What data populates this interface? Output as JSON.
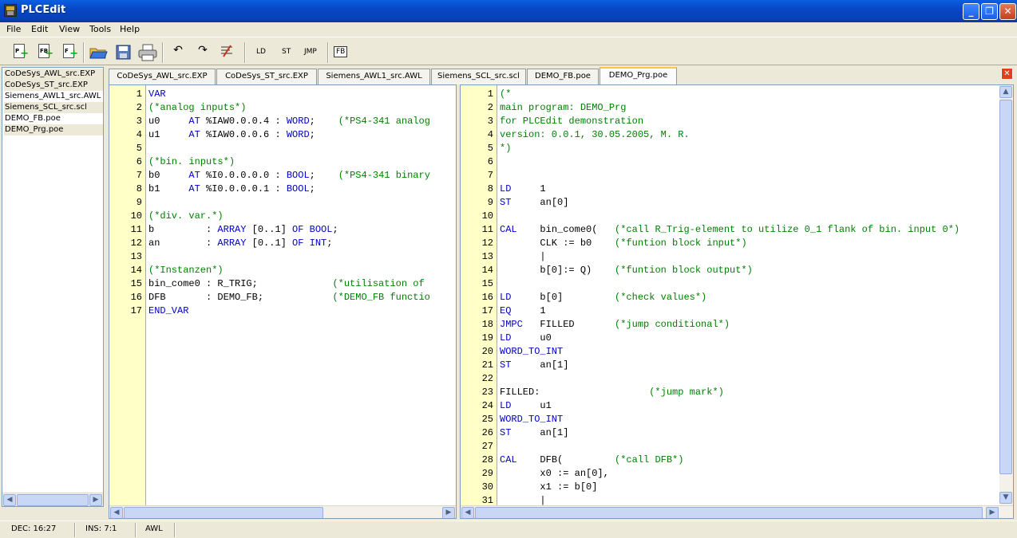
{
  "window": {
    "title": "PLCEdit"
  },
  "menu": [
    "File",
    "Edit",
    "View",
    "Tools",
    "Help"
  ],
  "toolbar": {
    "new_program_glyph": "P",
    "new_fb_glyph": "FB",
    "new_function_glyph": "F",
    "ld_label": "LD",
    "st_label": "ST",
    "jmp_label": "JMP",
    "fb_label": "FB"
  },
  "files": [
    "CoDeSys_AWL_src.EXP",
    "CoDeSys_ST_src.EXP",
    "Siemens_AWL1_src.AWL",
    "Siemens_SCL_src.scl",
    "DEMO_FB.poe",
    "DEMO_Prg.poe"
  ],
  "tabs": [
    "CoDeSys_AWL_src.EXP",
    "CoDeSys_ST_src.EXP",
    "Siemens_AWL1_src.AWL",
    "Siemens_SCL_src.scl",
    "DEMO_FB.poe",
    "DEMO_Prg.poe"
  ],
  "active_tab": "DEMO_Prg.poe",
  "left_editor": {
    "line_numbers": [
      "1",
      "2",
      "3",
      "4",
      "5",
      "6",
      "7",
      "8",
      "9",
      "10",
      "11",
      "12",
      "13",
      "14",
      "15",
      "16",
      "17"
    ],
    "lines": [
      [
        {
          "t": "VAR",
          "c": "k"
        }
      ],
      [
        {
          "t": "(*analog inputs*)",
          "c": "c"
        }
      ],
      [
        {
          "t": "u0     "
        },
        {
          "t": "AT",
          "c": "k"
        },
        {
          "t": " %IAW0.0.0.4 : "
        },
        {
          "t": "WORD",
          "c": "k"
        },
        {
          "t": ";    "
        },
        {
          "t": "(*PS4-341 analog",
          "c": "c"
        }
      ],
      [
        {
          "t": "u1     "
        },
        {
          "t": "AT",
          "c": "k"
        },
        {
          "t": " %IAW0.0.0.6 : "
        },
        {
          "t": "WORD",
          "c": "k"
        },
        {
          "t": ";"
        }
      ],
      [],
      [
        {
          "t": "(*bin. inputs*)",
          "c": "c"
        }
      ],
      [
        {
          "t": "b0     "
        },
        {
          "t": "AT",
          "c": "k"
        },
        {
          "t": " %I0.0.0.0.0 : "
        },
        {
          "t": "BOOL",
          "c": "k"
        },
        {
          "t": ";    "
        },
        {
          "t": "(*PS4-341 binary",
          "c": "c"
        }
      ],
      [
        {
          "t": "b1     "
        },
        {
          "t": "AT",
          "c": "k"
        },
        {
          "t": " %I0.0.0.0.1 : "
        },
        {
          "t": "BOOL",
          "c": "k"
        },
        {
          "t": ";"
        }
      ],
      [],
      [
        {
          "t": "(*div. var.*)",
          "c": "c"
        }
      ],
      [
        {
          "t": "b         : "
        },
        {
          "t": "ARRAY",
          "c": "k"
        },
        {
          "t": " [0..1] "
        },
        {
          "t": "OF",
          "c": "k"
        },
        {
          "t": " "
        },
        {
          "t": "BOOL",
          "c": "k"
        },
        {
          "t": ";"
        }
      ],
      [
        {
          "t": "an        : "
        },
        {
          "t": "ARRAY",
          "c": "k"
        },
        {
          "t": " [0..1] "
        },
        {
          "t": "OF",
          "c": "k"
        },
        {
          "t": " "
        },
        {
          "t": "INT",
          "c": "k"
        },
        {
          "t": ";"
        }
      ],
      [],
      [
        {
          "t": "(*Instanzen*)",
          "c": "c"
        }
      ],
      [
        {
          "t": "bin_come0 : R_TRIG;             "
        },
        {
          "t": "(*utilisation of",
          "c": "c"
        }
      ],
      [
        {
          "t": "DFB       : DEMO_FB;            "
        },
        {
          "t": "(*DEMO_FB functio",
          "c": "c"
        }
      ],
      [
        {
          "t": "END_VAR",
          "c": "k"
        }
      ]
    ]
  },
  "right_editor": {
    "line_numbers": [
      "1",
      "2",
      "3",
      "4",
      "5",
      "6",
      "7",
      "8",
      "9",
      "10",
      "11",
      "12",
      "13",
      "14",
      "15",
      "16",
      "17",
      "18",
      "19",
      "20",
      "21",
      "22",
      "23",
      "24",
      "25",
      "26",
      "27",
      "28",
      "29",
      "30",
      "31"
    ],
    "lines": [
      [
        {
          "t": "(*",
          "c": "c"
        }
      ],
      [
        {
          "t": "main program: DEMO_Prg",
          "c": "c"
        }
      ],
      [
        {
          "t": "for PLCEdit demonstration",
          "c": "c"
        }
      ],
      [
        {
          "t": "version: 0.0.1, 30.05.2005, M. R.",
          "c": "c"
        }
      ],
      [
        {
          "t": "*)",
          "c": "c"
        }
      ],
      [],
      [],
      [
        {
          "t": "LD",
          "c": "k"
        },
        {
          "t": "     1"
        }
      ],
      [
        {
          "t": "ST",
          "c": "k"
        },
        {
          "t": "     an[0]"
        }
      ],
      [],
      [
        {
          "t": "CAL",
          "c": "k"
        },
        {
          "t": "    bin_come0(   "
        },
        {
          "t": "(*call R_Trig-element to utilize 0_1 flank of bin. input 0*)",
          "c": "c"
        }
      ],
      [
        {
          "t": "       CLK := b0    "
        },
        {
          "t": "(*funtion block input*)",
          "c": "c"
        }
      ],
      [
        {
          "t": "       |"
        }
      ],
      [
        {
          "t": "       b[0]:= Q)    "
        },
        {
          "t": "(*funtion block output*)",
          "c": "c"
        }
      ],
      [],
      [
        {
          "t": "LD",
          "c": "k"
        },
        {
          "t": "     b[0]         "
        },
        {
          "t": "(*check values*)",
          "c": "c"
        }
      ],
      [
        {
          "t": "EQ",
          "c": "k"
        },
        {
          "t": "     1"
        }
      ],
      [
        {
          "t": "JMPC",
          "c": "k"
        },
        {
          "t": "   FILLED       "
        },
        {
          "t": "(*jump conditional*)",
          "c": "c"
        }
      ],
      [
        {
          "t": "LD",
          "c": "k"
        },
        {
          "t": "     u0"
        }
      ],
      [
        {
          "t": "WORD_TO_INT",
          "c": "k"
        }
      ],
      [
        {
          "t": "ST",
          "c": "k"
        },
        {
          "t": "     an[1]"
        }
      ],
      [],
      [
        {
          "t": "FILLED:                   "
        },
        {
          "t": "(*jump mark*)",
          "c": "c"
        }
      ],
      [
        {
          "t": "LD",
          "c": "k"
        },
        {
          "t": "     u1"
        }
      ],
      [
        {
          "t": "WORD_TO_INT",
          "c": "k"
        }
      ],
      [
        {
          "t": "ST",
          "c": "k"
        },
        {
          "t": "     an[1]"
        }
      ],
      [],
      [
        {
          "t": "CAL",
          "c": "k"
        },
        {
          "t": "    DFB(         "
        },
        {
          "t": "(*call DFB*)",
          "c": "c"
        }
      ],
      [
        {
          "t": "       x0 := an[0],"
        }
      ],
      [
        {
          "t": "       x1 := b[0]"
        }
      ],
      [
        {
          "t": "       |"
        }
      ]
    ]
  },
  "status": {
    "pos": "DEC: 16:27",
    "ins": "INS: 7:1",
    "lang": "AWL"
  },
  "colors": {
    "keyword": "#0000c8",
    "comment": "#008000",
    "gutter": "#ffffc8",
    "title_bar": "#0847c8",
    "active_tab_accent": "#ffc83c"
  }
}
